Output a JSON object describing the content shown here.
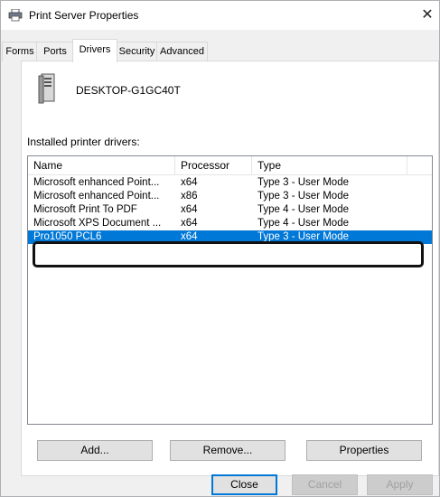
{
  "window": {
    "title": "Print Server Properties",
    "close_glyph": "✕"
  },
  "tabs": [
    {
      "label": "Forms"
    },
    {
      "label": "Ports"
    },
    {
      "label": "Drivers"
    },
    {
      "label": "Security"
    },
    {
      "label": "Advanced"
    }
  ],
  "active_tab": "Drivers",
  "server": {
    "name": "DESKTOP-G1GC40T"
  },
  "drivers_list": {
    "label": "Installed printer drivers:",
    "columns": [
      "Name",
      "Processor",
      "Type"
    ],
    "rows": [
      {
        "name": "Microsoft enhanced Point...",
        "processor": "x64",
        "type": "Type 3 - User Mode"
      },
      {
        "name": "Microsoft enhanced Point...",
        "processor": "x86",
        "type": "Type 3 - User Mode"
      },
      {
        "name": "Microsoft Print To PDF",
        "processor": "x64",
        "type": "Type 4 - User Mode"
      },
      {
        "name": "Microsoft XPS Document ...",
        "processor": "x64",
        "type": "Type 4 - User Mode"
      },
      {
        "name": "Pro1050 PCL6",
        "processor": "x64",
        "type": "Type 3 - User Mode"
      }
    ],
    "selected_row": "Pro1050 PCL6"
  },
  "buttons": {
    "add": "Add...",
    "remove": "Remove...",
    "properties": "Properties",
    "close": "Close",
    "cancel": "Cancel",
    "apply": "Apply"
  },
  "colors": {
    "selection": "#0078d7",
    "highlight_border": "#111111"
  }
}
